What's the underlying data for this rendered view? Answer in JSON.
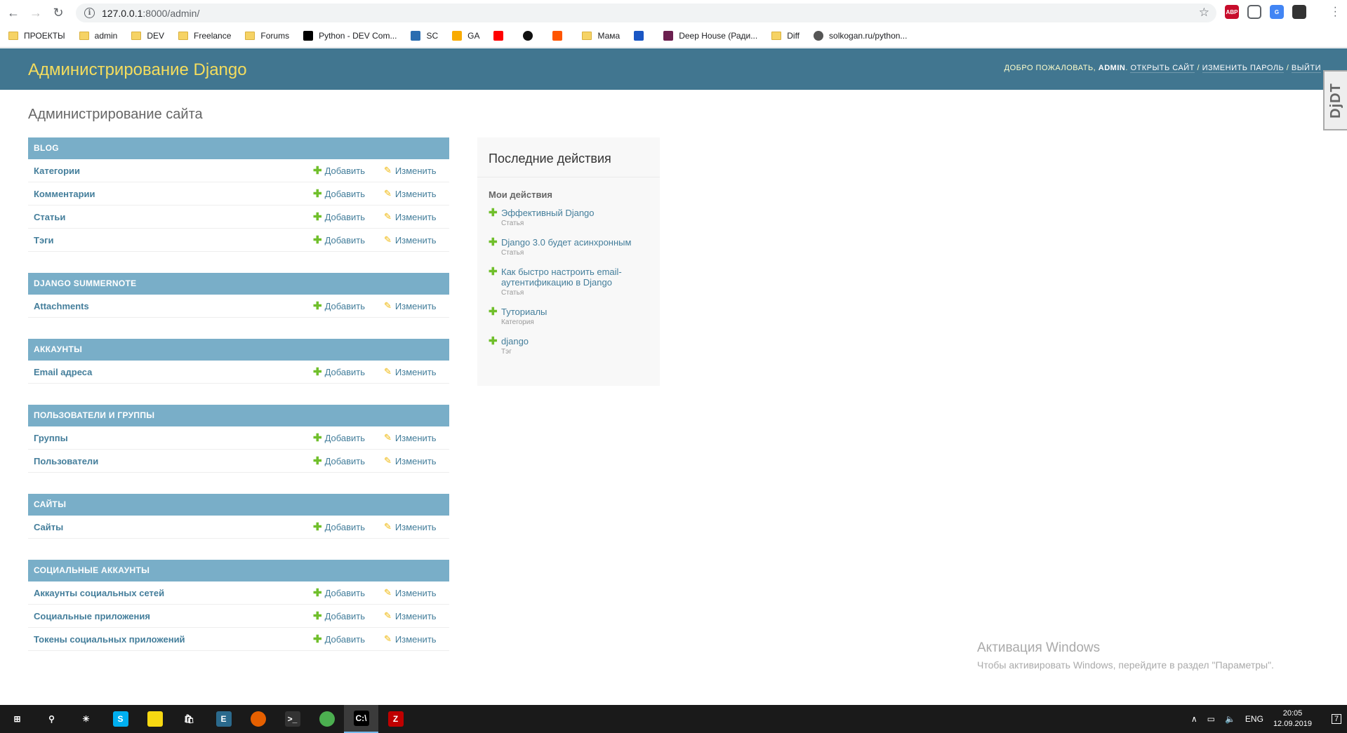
{
  "browser": {
    "url_host": "127.0.0.1",
    "url_path": ":8000/admin/",
    "bookmarks": [
      {
        "label": "ПРОЕКТЫ",
        "icon": "folder-icon"
      },
      {
        "label": "admin",
        "icon": "folder-icon"
      },
      {
        "label": "DEV",
        "icon": "folder-icon"
      },
      {
        "label": "Freelance",
        "icon": "folder-icon"
      },
      {
        "label": "Forums",
        "icon": "folder-icon"
      },
      {
        "label": "Python - DEV Com...",
        "icon": "dev-icon"
      },
      {
        "label": "SC",
        "icon": "sc-icon"
      },
      {
        "label": "GA",
        "icon": "analytics-icon"
      },
      {
        "label": "",
        "icon": "youtube-icon"
      },
      {
        "label": "",
        "icon": "github-icon"
      },
      {
        "label": "",
        "icon": "soundcloud-icon"
      },
      {
        "label": "Мама",
        "icon": "folder-icon"
      },
      {
        "label": "",
        "icon": "info-bookmark-icon"
      },
      {
        "label": "Deep House (Ради...",
        "icon": "radio-icon"
      },
      {
        "label": "Diff",
        "icon": "folder-icon"
      },
      {
        "label": "solkogan.ru/python...",
        "icon": "globe-icon"
      }
    ],
    "extensions": [
      {
        "label": "ABP",
        "color": "#c70d2c"
      },
      {
        "label": "",
        "color": "#fff"
      },
      {
        "label": "G",
        "color": "#4285f4"
      },
      {
        "label": "",
        "color": "#333"
      }
    ]
  },
  "header": {
    "branding": "Администрирование Django",
    "welcome": "Добро пожаловать,",
    "username": "admin",
    "view_site": "Открыть сайт",
    "change_password": "Изменить пароль",
    "logout": "Выйти",
    "separator": "/"
  },
  "ddt": "DjDT",
  "page_title": "Администрирование сайта",
  "add_label": "Добавить",
  "change_label": "Изменить",
  "modules": [
    {
      "caption": "Blog",
      "models": [
        "Категории",
        "Комментарии",
        "Статьи",
        "Тэги"
      ]
    },
    {
      "caption": "Django Summernote",
      "models": [
        "Attachments"
      ]
    },
    {
      "caption": "Аккаунты",
      "models": [
        "Email адреса"
      ]
    },
    {
      "caption": "Пользователи и группы",
      "models": [
        "Группы",
        "Пользователи"
      ]
    },
    {
      "caption": "Сайты",
      "models": [
        "Сайты"
      ]
    },
    {
      "caption": "Социальные аккаунты",
      "models": [
        "Аккаунты социальных сетей",
        "Социальные приложения",
        "Токены социальных приложений"
      ]
    }
  ],
  "recent": {
    "title": "Последние действия",
    "subtitle": "Мои действия",
    "actions": [
      {
        "name": "Эффективный Django",
        "type": "Статья"
      },
      {
        "name": "Django 3.0 будет асинхронным",
        "type": "Статья"
      },
      {
        "name": "Как быстро настроить email-аутентификацию в Django",
        "type": "Статья"
      },
      {
        "name": "Туториалы",
        "type": "Категория"
      },
      {
        "name": "django",
        "type": "Тэг"
      }
    ]
  },
  "watermark": {
    "line1": "Активация Windows",
    "line2": "Чтобы активировать Windows, перейдите в раздел \"Параметры\"."
  },
  "taskbar": {
    "lang": "ENG",
    "time": "20:05",
    "date": "12.09.2019",
    "notifications": "7",
    "apps": [
      {
        "name": "start-icon",
        "label": "⊞",
        "color": "#1a1a1a"
      },
      {
        "name": "search-icon",
        "label": "⚲",
        "color": "#1a1a1a"
      },
      {
        "name": "sun-icon",
        "label": "☀",
        "color": "#1a1a1a"
      },
      {
        "name": "skype-icon",
        "label": "S",
        "color": "#00aff0"
      },
      {
        "name": "sticky-notes-icon",
        "label": "",
        "color": "#f7d812"
      },
      {
        "name": "store-icon",
        "label": "🛍",
        "color": "#1a1a1a"
      },
      {
        "name": "editor-icon",
        "label": "E",
        "color": "#2b6a8d"
      },
      {
        "name": "firefox-icon",
        "label": "",
        "color": "#e66000"
      },
      {
        "name": "terminal-icon",
        "label": ">_",
        "color": "#333"
      },
      {
        "name": "chrome-icon",
        "label": "",
        "color": "#4caf50"
      },
      {
        "name": "cmd-icon",
        "label": "C:\\",
        "color": "#000"
      },
      {
        "name": "filezilla-icon",
        "label": "Z",
        "color": "#bf0000"
      }
    ]
  }
}
